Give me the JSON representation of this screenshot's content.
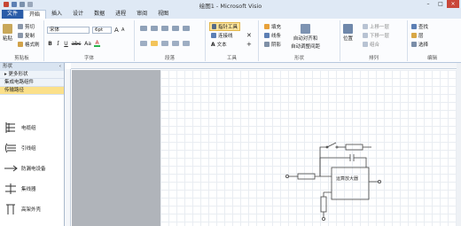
{
  "window": {
    "title": "绘图1 - Microsoft Visio"
  },
  "tabs": [
    "文件",
    "开始",
    "插入",
    "设计",
    "数据",
    "进程",
    "审阅",
    "视图"
  ],
  "clipboard": {
    "paste": "粘贴",
    "cut": "剪切",
    "copy": "复制",
    "format_painter": "格式刷",
    "label": "剪贴板"
  },
  "font": {
    "family": "宋体",
    "size": "6pt",
    "grow": "A",
    "shrink": "A",
    "bold": "B",
    "italic": "I",
    "underline": "U",
    "strike": "abc",
    "case": "Aa",
    "color": "A",
    "label": "字体"
  },
  "paragraph": {
    "label": "段落"
  },
  "tools": {
    "pointer": "指针工具",
    "connector": "连接线",
    "text": "文本",
    "label": "工具"
  },
  "shape_group": {
    "fill": "填充",
    "line": "线条",
    "shadow": "阴影",
    "label": "形状"
  },
  "arrange": {
    "align": "自动对齐和",
    "align2": "自动调整间距",
    "position": "位置",
    "bring_forward": "上移一层",
    "send_backward": "下移一层",
    "group": "组合",
    "label": "排列"
  },
  "editing": {
    "find": "查找",
    "layers": "层",
    "select": "选择",
    "label": "编辑"
  },
  "shapes_panel": {
    "title": "形状",
    "more": "更多形状",
    "stencils": [
      "集成电路组件",
      "传输路径"
    ],
    "shapes": [
      "电缆组",
      "引线组",
      "防漏电设备",
      "集线器",
      "高架外壳"
    ]
  },
  "diagram": {
    "amp_label": "运算放大器"
  },
  "colors": {
    "accent": "#2a5ca8",
    "ribbon_bg": "#fbfcfe",
    "canvas_gray": "#b0b4ba",
    "highlight": "#fbe08a"
  }
}
